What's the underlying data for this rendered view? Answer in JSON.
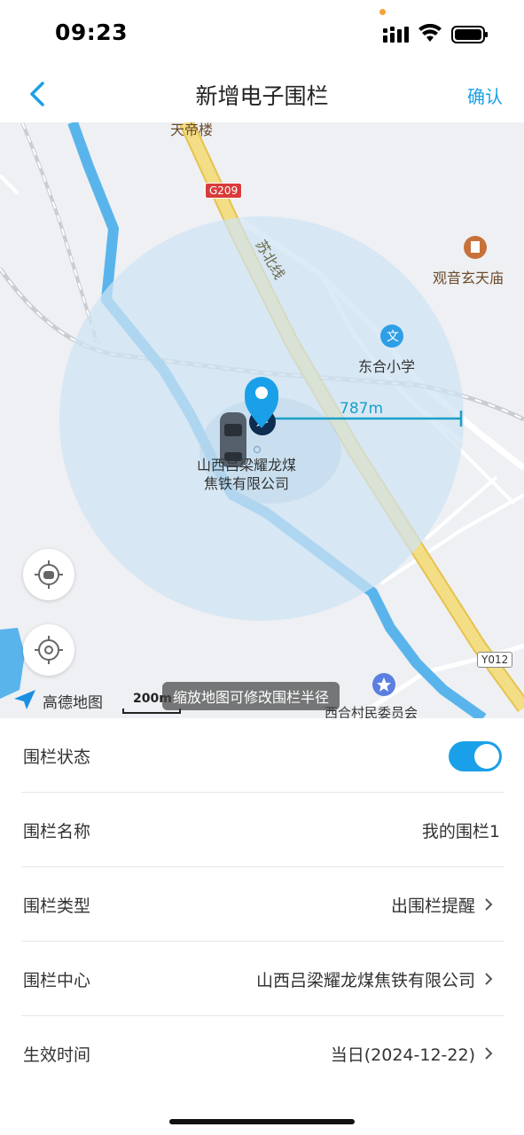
{
  "status_bar": {
    "time": "09:23"
  },
  "nav": {
    "title": "新增电子围栏",
    "confirm_label": "确认"
  },
  "map": {
    "labels": {
      "top_building": "天帝楼",
      "road_g209": "G209",
      "road_subei": "苏北线",
      "poi_temple": "观音玄天庙",
      "poi_school": "东合小学",
      "school_icon_char": "文",
      "company_line1": "山西吕梁耀龙煤",
      "company_line2": "焦铁有限公司",
      "radius": "787m",
      "road_y012": "Y012",
      "poi_village": "西合村民委员会"
    },
    "logo_text": "高德地图",
    "scale_text": "200m",
    "hint": "缩放地图可修改围栏半径",
    "fence_color": "#cfe3f2",
    "river_color": "#5ab4ec",
    "highway_color": "#f0d46a"
  },
  "settings": {
    "rows": [
      {
        "label": "围栏状态",
        "toggle_on": true
      },
      {
        "label": "围栏名称",
        "value": "我的围栏1"
      },
      {
        "label": "围栏类型",
        "value": "出围栏提醒"
      },
      {
        "label": "围栏中心",
        "value": "山西吕梁耀龙煤焦铁有限公司"
      },
      {
        "label": "生效时间",
        "value": "当日(2024-12-22)"
      }
    ]
  },
  "colors": {
    "accent": "#1aa0e8"
  }
}
